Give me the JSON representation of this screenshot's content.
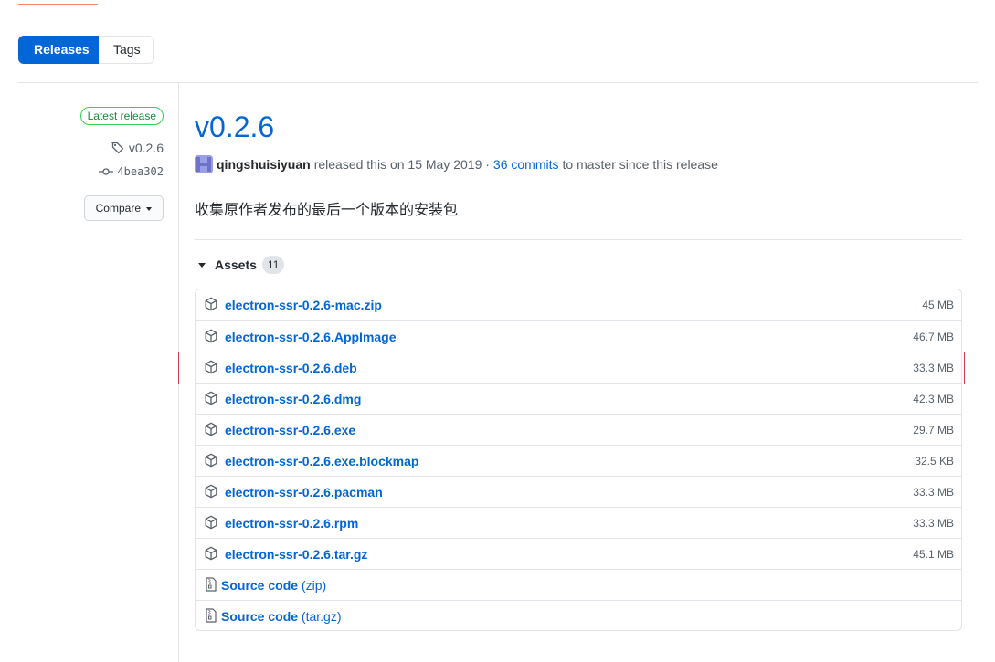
{
  "tabs": {
    "releases": "Releases",
    "tags": "Tags"
  },
  "sidebar": {
    "latest_badge": "Latest release",
    "tag": "v0.2.6",
    "commit": "4bea302",
    "compare_label": "Compare"
  },
  "release": {
    "title": "v0.2.6",
    "author": "qingshuisiyuan",
    "released_text": "released this on 15 May 2019 ·",
    "commits_link": "36 commits",
    "since_text": "to master since this release",
    "body": "收集原作者发布的最后一个版本的安装包"
  },
  "assets": {
    "heading": "Assets",
    "count": "11",
    "files": [
      {
        "name": "electron-ssr-0.2.6-mac.zip",
        "size": "45 MB"
      },
      {
        "name": "electron-ssr-0.2.6.AppImage",
        "size": "46.7 MB"
      },
      {
        "name": "electron-ssr-0.2.6.deb",
        "size": "33.3 MB"
      },
      {
        "name": "electron-ssr-0.2.6.dmg",
        "size": "42.3 MB"
      },
      {
        "name": "electron-ssr-0.2.6.exe",
        "size": "29.7 MB"
      },
      {
        "name": "electron-ssr-0.2.6.exe.blockmap",
        "size": "32.5 KB"
      },
      {
        "name": "electron-ssr-0.2.6.pacman",
        "size": "33.3 MB"
      },
      {
        "name": "electron-ssr-0.2.6.rpm",
        "size": "33.3 MB"
      },
      {
        "name": "electron-ssr-0.2.6.tar.gz",
        "size": "45.1 MB"
      }
    ],
    "source": [
      {
        "label": "Source code",
        "ext": "(zip)"
      },
      {
        "label": "Source code",
        "ext": "(tar.gz)"
      }
    ]
  },
  "colors": {
    "link": "#0366d6",
    "primary": "#0366d6",
    "latest": "#22863a",
    "highlight": "#d73a49"
  }
}
